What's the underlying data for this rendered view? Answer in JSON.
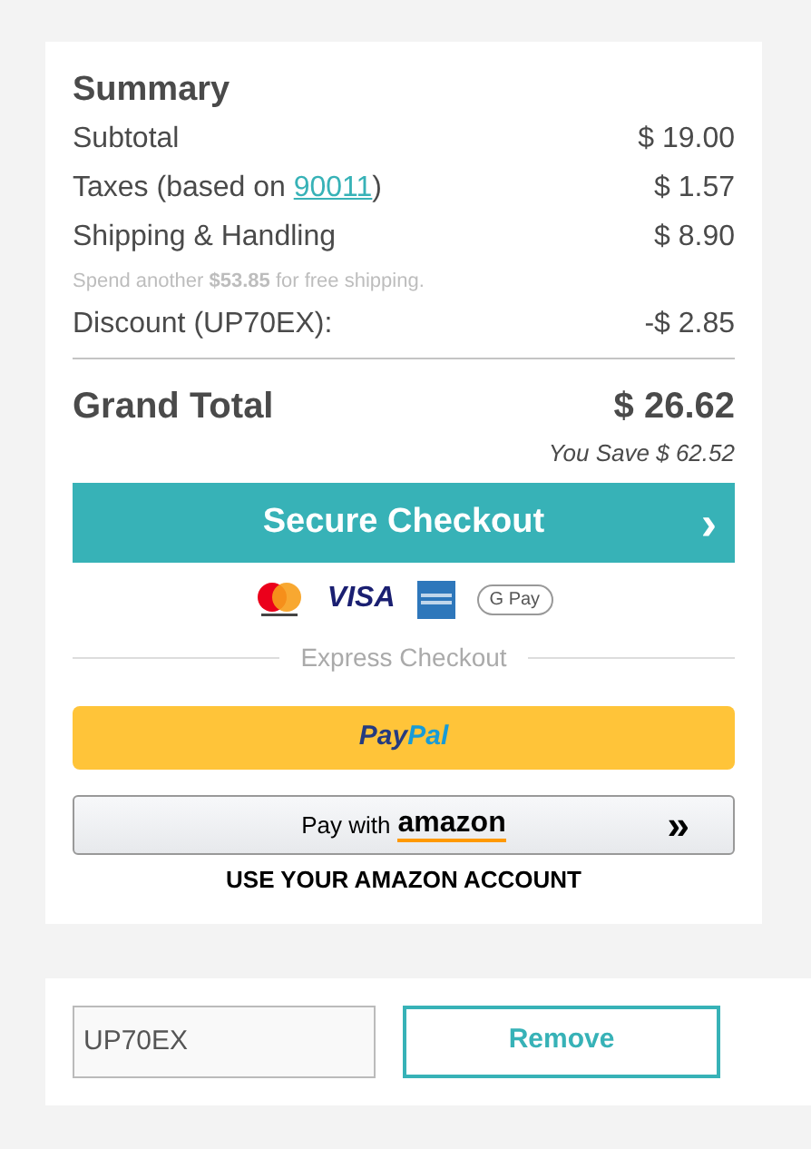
{
  "summary": {
    "title": "Summary",
    "lines": [
      {
        "label": "Subtotal",
        "value": "$ 19.00"
      },
      {
        "label": "Taxes (based on ",
        "link": "90011",
        "label_after": ")",
        "value": "$ 1.57"
      },
      {
        "label": "Shipping & Handling",
        "value": "$ 8.90"
      }
    ],
    "shipping_note": "Spend another **$53.85** for free shipping.",
    "discount": {
      "label": "Discount (UP70EX):",
      "value": "-$ 2.85"
    },
    "grand_total": {
      "label": "Grand Total",
      "value": "$ 26.62"
    },
    "savings": "You Save $ 62.52"
  },
  "checkout_button": {
    "label": "Secure Checkout",
    "arrow": "›"
  },
  "payment_logos": {
    "visa": "VISA",
    "gpay": "G Pay"
  },
  "express_divider": "Express Checkout",
  "paypal_button": {
    "pay": "Pay",
    "pal": "Pal"
  },
  "amazon_button": {
    "prefix": "Pay with",
    "brand": "amazon",
    "arrow": "»"
  },
  "amazon_note": "USE YOUR AMAZON ACCOUNT",
  "coupon": {
    "value": "UP70EX",
    "button": "Remove"
  }
}
